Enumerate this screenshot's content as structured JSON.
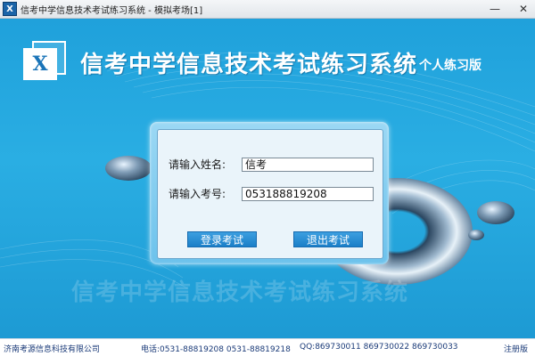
{
  "window": {
    "title": "信考中学信息技术考试练习系统 - 模拟考场[1]",
    "icon_letter": "X",
    "controls": {
      "minimize": "—",
      "close": "✕"
    }
  },
  "header": {
    "logo_letter": "X",
    "title": "信考中学信息技术考试练习系统",
    "edition": "个人练习版"
  },
  "login": {
    "name_label": "请输入姓名:",
    "name_value": "信考",
    "id_label": "请输入考号:",
    "id_value": "053188819208",
    "login_button": "登录考试",
    "exit_button": "退出考试"
  },
  "footer": {
    "company": "济南考源信息科技有限公司",
    "phone": "电话:0531-88819208   0531-88819218",
    "qq": "QQ:869730011   869730022   869730033",
    "register": "注册版"
  },
  "colors": {
    "background": "#1e9fda",
    "button": "#1b7fc8",
    "dialog": "#eaf4fa",
    "footer_text": "#1a3a78"
  }
}
